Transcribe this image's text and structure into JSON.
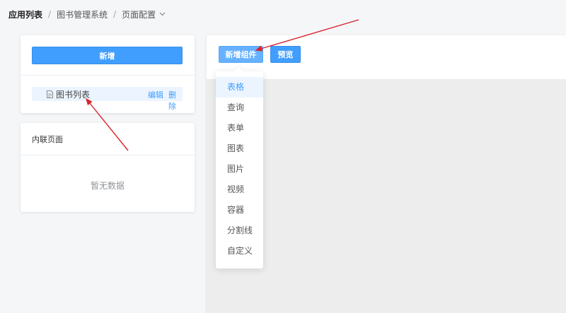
{
  "breadcrumb": {
    "root": "应用列表",
    "app": "图书管理系统",
    "current": "页面配置"
  },
  "left_panel": {
    "add_button": "新增",
    "pages": [
      {
        "name": "图书列表",
        "edit": "编辑",
        "delete": "删除"
      }
    ]
  },
  "inline_panel": {
    "title": "内联页面",
    "empty_text": "暂无数据"
  },
  "toolbar": {
    "add_component": "新增组件",
    "preview": "预览"
  },
  "component_menu": {
    "items": [
      "表格",
      "查询",
      "表单",
      "图表",
      "图片",
      "视频",
      "容器",
      "分割线",
      "自定义"
    ],
    "active_index": 0
  },
  "colors": {
    "primary": "#409eff",
    "annotation_arrow": "#d9232d"
  },
  "icons": [
    "chevron-down-icon",
    "document-icon"
  ]
}
